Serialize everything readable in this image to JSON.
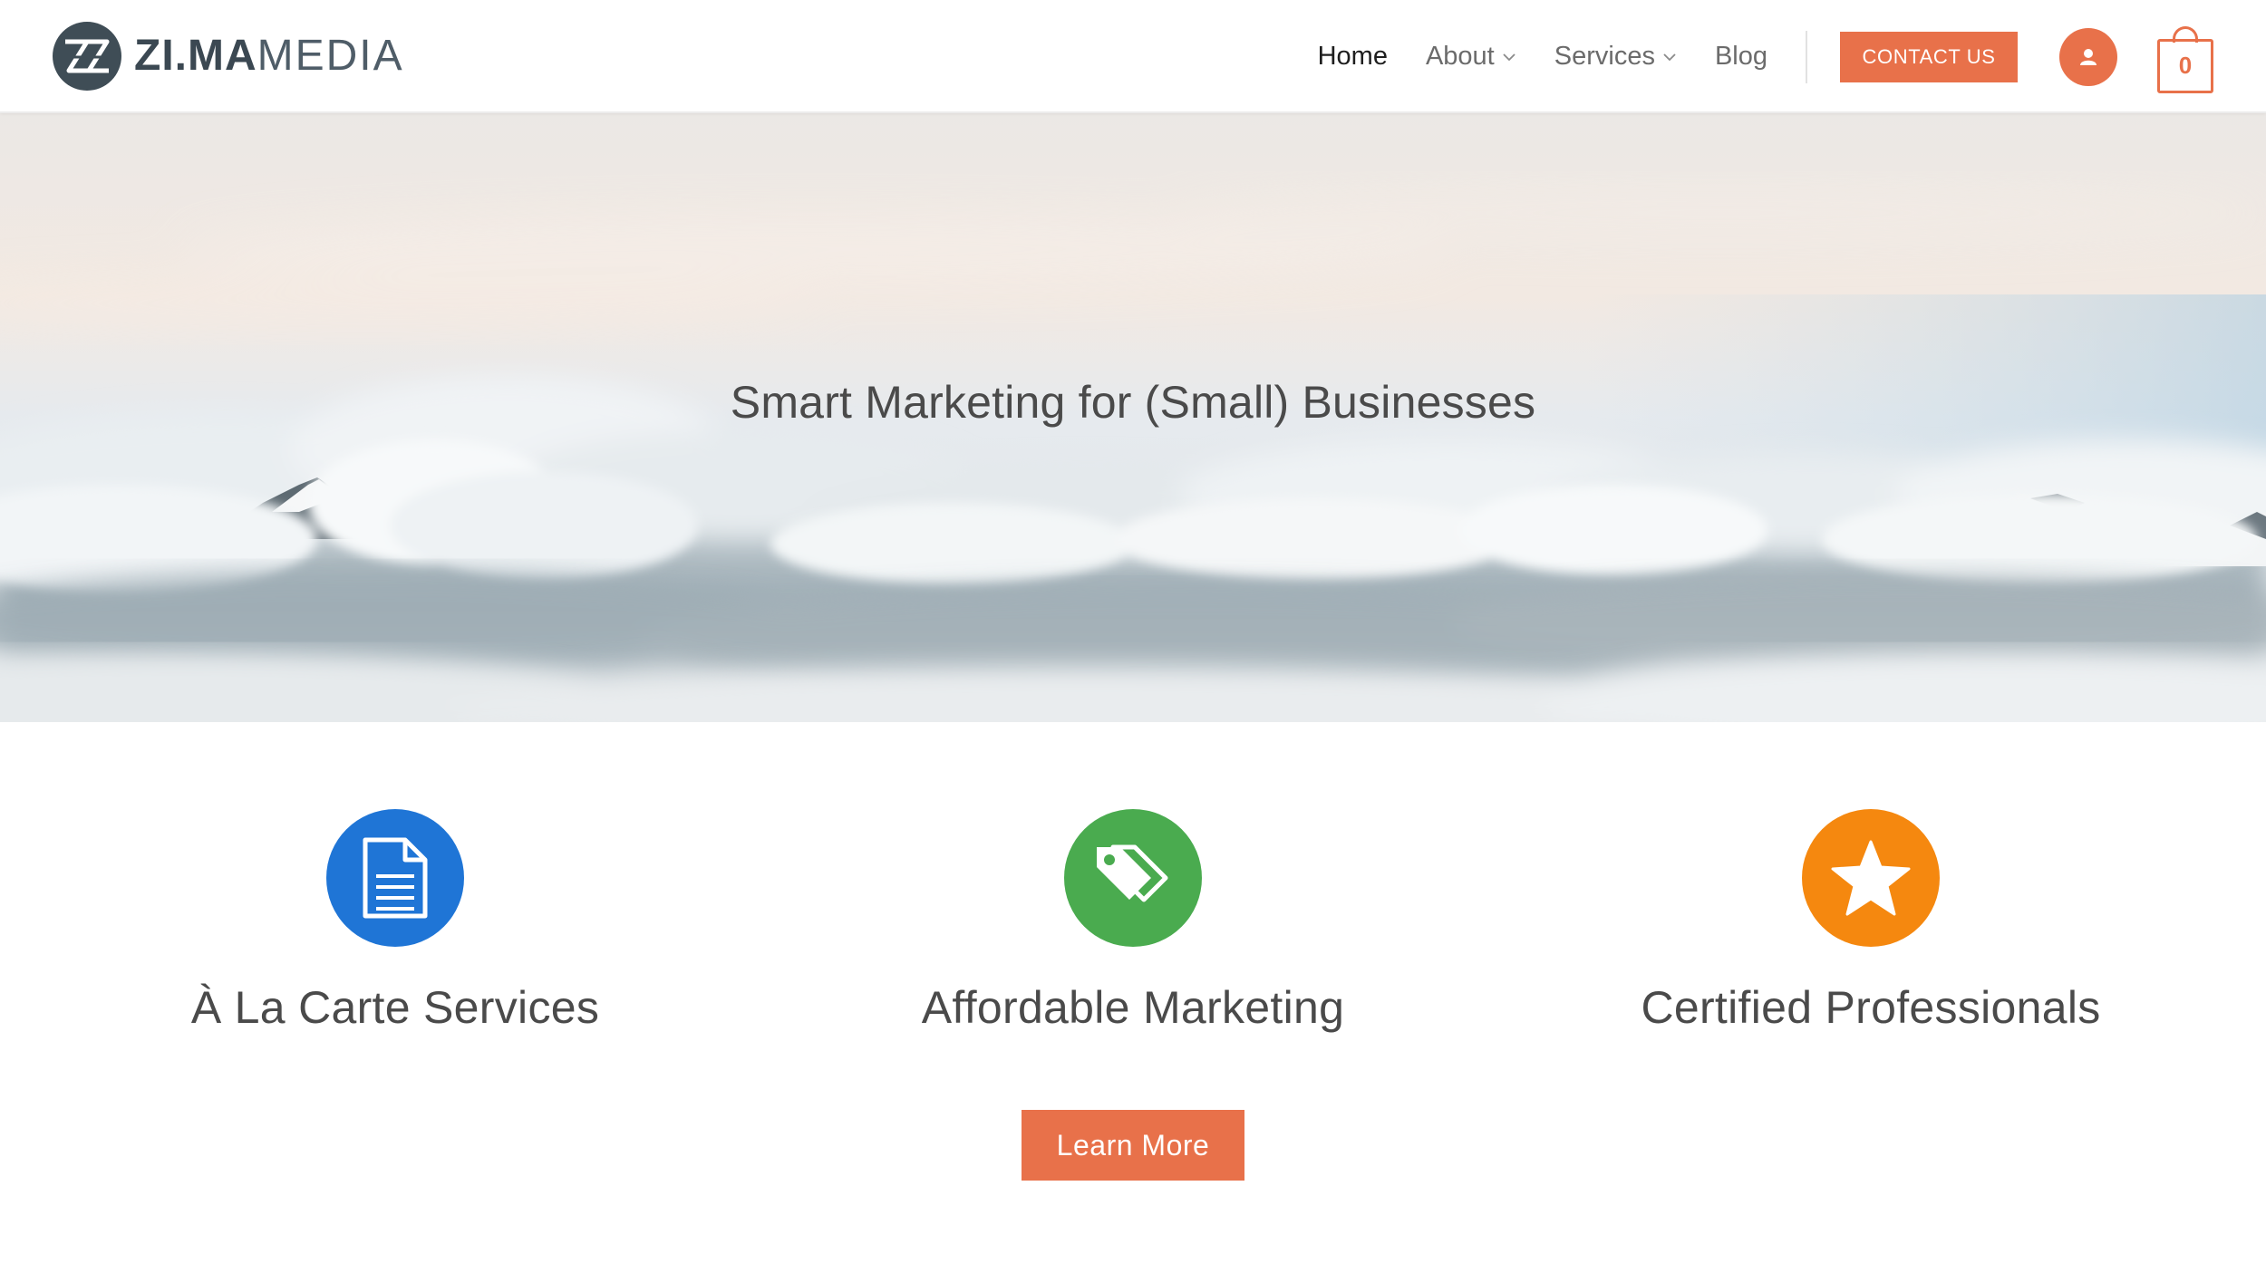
{
  "header": {
    "logo": {
      "bold_text": "ZI.MA",
      "thin_text": "MEDIA",
      "icon": "zima-logo-icon"
    },
    "nav": [
      {
        "label": "Home",
        "active": true
      },
      {
        "label": "About",
        "dropdown": true
      },
      {
        "label": "Services",
        "dropdown": true
      },
      {
        "label": "Blog"
      }
    ],
    "contact_label": "CONTACT US",
    "user_icon": "user-icon",
    "cart_count": "0"
  },
  "hero": {
    "title": "Smart Marketing for (Small) Businesses"
  },
  "features": [
    {
      "title": "À La Carte Services",
      "icon": "document-icon",
      "color": "#1f75d6"
    },
    {
      "title": "Affordable Marketing",
      "icon": "tags-icon",
      "color": "#4aab4f"
    },
    {
      "title": "Certified Professionals",
      "icon": "star-icon",
      "color": "#f5880f"
    }
  ],
  "cta": {
    "label": "Learn More"
  },
  "colors": {
    "accent": "#e8714a",
    "text": "#4a4a4a"
  }
}
